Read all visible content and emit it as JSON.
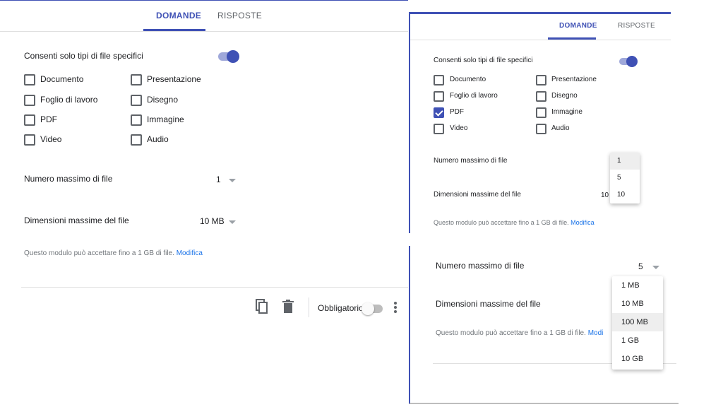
{
  "left": {
    "tabs": {
      "active": "DOMANDE",
      "inactive": "RISPOSTE"
    },
    "file_types_toggle_label": "Consenti solo tipi di file specifici",
    "file_types": [
      {
        "label": "Documento",
        "checked": false
      },
      {
        "label": "Presentazione",
        "checked": false
      },
      {
        "label": "Foglio di lavoro",
        "checked": false
      },
      {
        "label": "Disegno",
        "checked": false
      },
      {
        "label": "PDF",
        "checked": false
      },
      {
        "label": "Immagine",
        "checked": false
      },
      {
        "label": "Video",
        "checked": false
      },
      {
        "label": "Audio",
        "checked": false
      }
    ],
    "max_files_label": "Numero massimo di file",
    "max_files_value": "1",
    "max_size_label": "Dimensioni massime del file",
    "max_size_value": "10 MB",
    "hint_text": "Questo modulo può accettare fino a 1 GB di file.",
    "hint_link": "Modifica",
    "required_label": "Obbligatorio"
  },
  "right_top": {
    "tabs": {
      "active": "DOMANDE",
      "inactive": "RISPOSTE"
    },
    "file_types_toggle_label": "Consenti solo tipi di file specifici",
    "file_types": [
      {
        "label": "Documento",
        "checked": false
      },
      {
        "label": "Presentazione",
        "checked": false
      },
      {
        "label": "Foglio di lavoro",
        "checked": false
      },
      {
        "label": "Disegno",
        "checked": false
      },
      {
        "label": "PDF",
        "checked": true
      },
      {
        "label": "Immagine",
        "checked": false
      },
      {
        "label": "Video",
        "checked": false
      },
      {
        "label": "Audio",
        "checked": false
      }
    ],
    "max_files_label": "Numero massimo di file",
    "max_files_options": [
      "1",
      "5",
      "10"
    ],
    "max_files_selected": "1",
    "max_size_label": "Dimensioni massime del file",
    "max_size_value_partial": "10",
    "hint_text": "Questo modulo può accettare fino a 1 GB di file.",
    "hint_link": "Modifica"
  },
  "right_bottom": {
    "max_files_label": "Numero massimo di file",
    "max_files_value": "5",
    "max_size_label": "Dimensioni massime del file",
    "max_size_options": [
      "1 MB",
      "10 MB",
      "100 MB",
      "1 GB",
      "10 GB"
    ],
    "max_size_selected": "100 MB",
    "hint_text": "Questo modulo può accettare fino a 1 GB di file.",
    "hint_link_partial": "Modi"
  },
  "colors": {
    "accent": "#3f51b5",
    "link": "#1a73e8",
    "muted": "#70757a"
  }
}
